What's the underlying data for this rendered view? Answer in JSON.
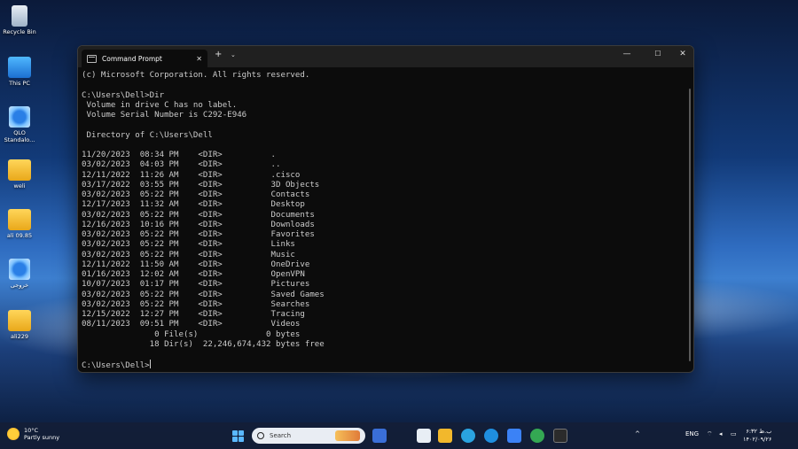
{
  "desktop": {
    "icons": [
      {
        "label": "Recycle Bin"
      },
      {
        "label": "This PC"
      },
      {
        "label": "QLO Standalo..."
      },
      {
        "label": "weli"
      },
      {
        "label": "ali 09.85"
      },
      {
        "label": "خروجی"
      },
      {
        "label": "ali229"
      }
    ]
  },
  "window": {
    "tab_title": "Command Prompt",
    "tab_close": "✕",
    "new_tab": "+",
    "dropdown": "⌄",
    "minimize": "—",
    "maximize": "☐",
    "close": "✕"
  },
  "console": {
    "lines": [
      "(c) Microsoft Corporation. All rights reserved.",
      "",
      "C:\\Users\\Dell>Dir",
      " Volume in drive C has no label.",
      " Volume Serial Number is C292-E946",
      "",
      " Directory of C:\\Users\\Dell",
      "",
      "11/20/2023  08:34 PM    <DIR>          .",
      "03/02/2023  04:03 PM    <DIR>          ..",
      "12/11/2022  11:26 AM    <DIR>          .cisco",
      "03/17/2022  03:55 PM    <DIR>          3D Objects",
      "03/02/2023  05:22 PM    <DIR>          Contacts",
      "12/17/2023  11:32 AM    <DIR>          Desktop",
      "03/02/2023  05:22 PM    <DIR>          Documents",
      "12/16/2023  10:16 PM    <DIR>          Downloads",
      "03/02/2023  05:22 PM    <DIR>          Favorites",
      "03/02/2023  05:22 PM    <DIR>          Links",
      "03/02/2023  05:22 PM    <DIR>          Music",
      "12/11/2022  11:50 AM    <DIR>          OneDrive",
      "01/16/2023  12:02 AM    <DIR>          OpenVPN",
      "10/07/2023  01:17 PM    <DIR>          Pictures",
      "03/02/2023  05:22 PM    <DIR>          Saved Games",
      "03/02/2023  05:22 PM    <DIR>          Searches",
      "12/15/2022  12:27 PM    <DIR>          Tracing",
      "08/11/2023  09:51 PM    <DIR>          Videos",
      "               0 File(s)              0 bytes",
      "              18 Dir(s)  22,246,674,432 bytes free",
      ""
    ],
    "prompt": "C:\\Users\\Dell>"
  },
  "taskbar": {
    "weather_temp": "10°C",
    "weather_desc": "Partly sunny",
    "search_label": "Search",
    "language": "ENG",
    "time": "ب.ظ ۶:۳۲",
    "date": "۱۴۰۲/۰۹/۲۶",
    "tray_up": "^",
    "colors": {
      "edge": "#1f8fe0",
      "chrome": "#34a853",
      "telegram": "#2aa3e0",
      "folder": "#f2b82c",
      "store": "#3b82f6",
      "terminal": "#2b2b2b"
    }
  }
}
